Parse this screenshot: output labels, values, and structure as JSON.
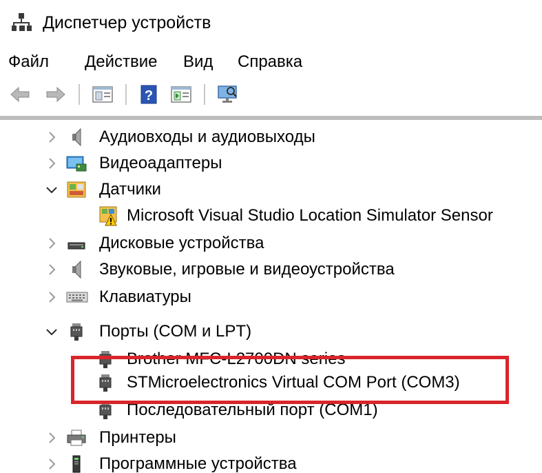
{
  "window": {
    "title": "Диспетчер устройств",
    "icon": "device-manager-icon"
  },
  "menu": [
    {
      "label": "Файл"
    },
    {
      "label": "Действие"
    },
    {
      "label": "Вид"
    },
    {
      "label": "Справка"
    }
  ],
  "toolbar": {
    "buttons": [
      "back-arrow-icon",
      "forward-arrow-icon",
      "properties-icon",
      "help-icon",
      "update-driver-icon",
      "scan-hardware-icon"
    ]
  },
  "tree": [
    {
      "label": "Аудиовходы и аудиовыходы",
      "icon": "speaker-icon",
      "expander": "collapsed"
    },
    {
      "label": "Видеоадаптеры",
      "icon": "monitor-icon",
      "expander": "collapsed"
    },
    {
      "label": "Датчики",
      "icon": "sensor-icon",
      "expander": "expanded"
    },
    {
      "label": "Microsoft Visual Studio Location Simulator Sensor",
      "icon": "warning-sensor-icon",
      "expander": "none"
    },
    {
      "label": "Дисковые устройства",
      "icon": "disk-icon",
      "expander": "collapsed"
    },
    {
      "label": "Звуковые, игровые и видеоустройства",
      "icon": "speaker-icon",
      "expander": "collapsed"
    },
    {
      "label": "Клавиатуры",
      "icon": "keyboard-icon",
      "expander": "collapsed"
    },
    {
      "label": "Порты (COM и LPT)",
      "icon": "port-icon",
      "expander": "expanded"
    },
    {
      "label": "Brother MFC-L2700DN series",
      "icon": "port-icon",
      "expander": "none"
    },
    {
      "label": "STMicroelectronics Virtual COM Port (COM3)",
      "icon": "port-icon",
      "expander": "none"
    },
    {
      "label": "Последовательный порт (COM1)",
      "icon": "port-icon",
      "expander": "none"
    },
    {
      "label": "Принтеры",
      "icon": "printer-icon",
      "expander": "collapsed"
    },
    {
      "label": "Программные устройства",
      "icon": "software-device-icon",
      "expander": "collapsed"
    }
  ],
  "annotation": {
    "color": "#d9252b",
    "target": "STMicroelectronics Virtual COM Port (COM3)"
  }
}
